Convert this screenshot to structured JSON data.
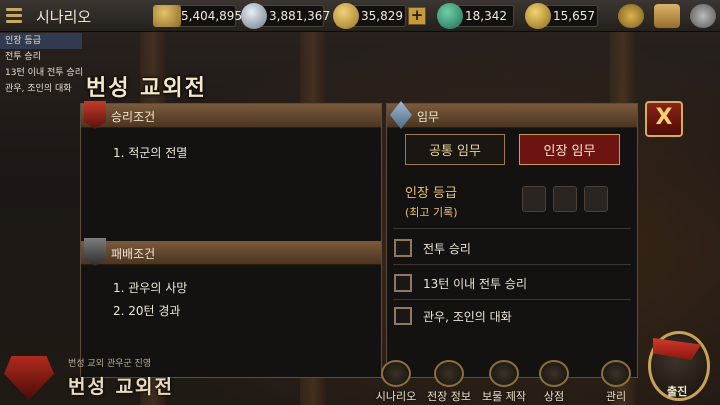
{
  "topbar": {
    "scenario_label": "시나리오",
    "resources": [
      {
        "icon": "gold-bar-icon",
        "value": "5,404,895"
      },
      {
        "icon": "silver-coin-icon",
        "value": "3,881,367"
      },
      {
        "icon": "copper-coin-icon",
        "value": "35,829"
      },
      {
        "icon": "jade-horse-icon",
        "value": "18,342"
      },
      {
        "icon": "gold-ingot-icon",
        "value": "15,657"
      }
    ],
    "plus_label": "+"
  },
  "mission_list": [
    "인장 등급",
    "전투 승리",
    "13턴 이내 전투 승리",
    "관우, 조인의 대화"
  ],
  "dialog": {
    "title": "번성 교외전",
    "victory": {
      "header": "승리조건",
      "items": [
        "1. 적군의 전멸"
      ]
    },
    "defeat": {
      "header": "패배조건",
      "items": [
        "1. 관우의 사망",
        "2. 20턴 경과"
      ]
    },
    "mission": {
      "header": "임무",
      "tabs": [
        "공통 임무",
        "인장 임무"
      ],
      "active_tab": 1,
      "grade_label": "인장 등급",
      "grade_sub": "(최고 기록)",
      "tasks": [
        "전투 승리",
        "13턴 이내 전투 승리",
        "관우, 조인의 대화"
      ],
      "tasks_checked": [
        false,
        false,
        false
      ]
    },
    "close_label": "X"
  },
  "bottom": {
    "subtitle": "번성 교외 관우군 진영",
    "title": "번성 교외전",
    "nav": [
      "시나리오",
      "전장 정보",
      "보물 제작",
      "상점",
      "관리"
    ],
    "sortie": "출진"
  },
  "colors": {
    "accent_gold": "#c69b57",
    "active_tab_bg": "#6e1410",
    "close_btn": "#8c2317"
  }
}
